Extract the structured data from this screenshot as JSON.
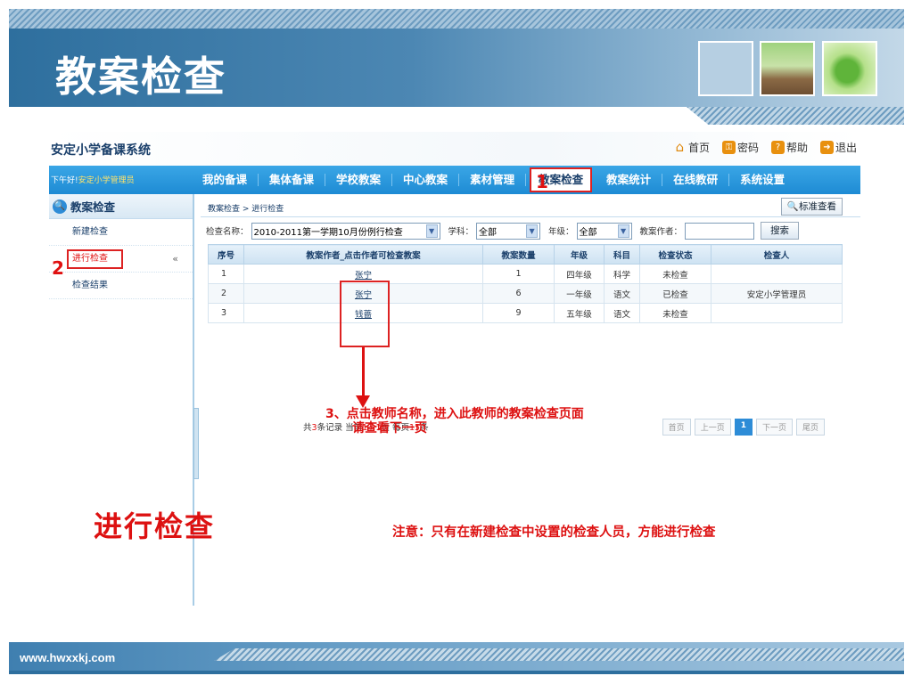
{
  "slide": {
    "title": "教案检查",
    "footer_url": "www.hwxxkj.com"
  },
  "app": {
    "title": "安定小学备课系统",
    "top_links": {
      "home": "首页",
      "password": "密码",
      "help": "帮助",
      "logout": "退出"
    },
    "greeting_prefix": "下午好!",
    "greeting_user": "安定小学管理员",
    "nav": [
      "我的备课",
      "集体备课",
      "学校教案",
      "中心教案",
      "素材管理",
      "教案检查",
      "教案统计",
      "在线教研",
      "系统设置"
    ],
    "nav_active_index": 5
  },
  "sidebar": {
    "header": "教案检查",
    "items": [
      {
        "label": "新建检查"
      },
      {
        "label": "进行检查",
        "active": true
      },
      {
        "label": "检查结果"
      }
    ],
    "collapse_glyph": "«"
  },
  "main": {
    "breadcrumb": "教案检查 > 进行检查",
    "std_button": "标准查看",
    "filters": {
      "name_label": "检查名称：",
      "name_value": "2010-2011第一学期10月份例行检查",
      "subject_label": "学科：",
      "subject_value": "全部",
      "grade_label": "年级：",
      "grade_value": "全部",
      "author_label": "教案作者：",
      "search_button": "搜索"
    },
    "table": {
      "headers": [
        "序号",
        "教案作者_点击作者可检查教案",
        "教案数量",
        "年级",
        "科目",
        "检查状态",
        "检查人"
      ],
      "rows": [
        [
          "1",
          "张宁",
          "1",
          "四年级",
          "科学",
          "未检查",
          ""
        ],
        [
          "2",
          "张宁",
          "6",
          "一年级",
          "语文",
          "已检查",
          "安定小学管理员"
        ],
        [
          "3",
          "钱蔷",
          "9",
          "五年级",
          "语文",
          "未检查",
          ""
        ]
      ]
    },
    "pager": {
      "p1": "共",
      "total": "3",
      "p2": "条记录 当前",
      "current": "1 / 1",
      "p3": "页 每页",
      "per_page": "15",
      "p4": "条",
      "buttons": {
        "first": "首页",
        "prev": "上一页",
        "page": "1",
        "next": "下一页",
        "last": "尾页"
      }
    }
  },
  "annotations": {
    "step1": "1",
    "step2": "2",
    "step3_line1": "3、点击教师名称，进入此教师的教案检查页面",
    "step3_line2": "请查看下一页",
    "big_label": "进行检查",
    "notice": "注意：只有在新建检查中设置的检查人员，方能进行检查"
  },
  "colors": {
    "accent_blue": "#1e8bd4",
    "annotation_red": "#d11111"
  }
}
